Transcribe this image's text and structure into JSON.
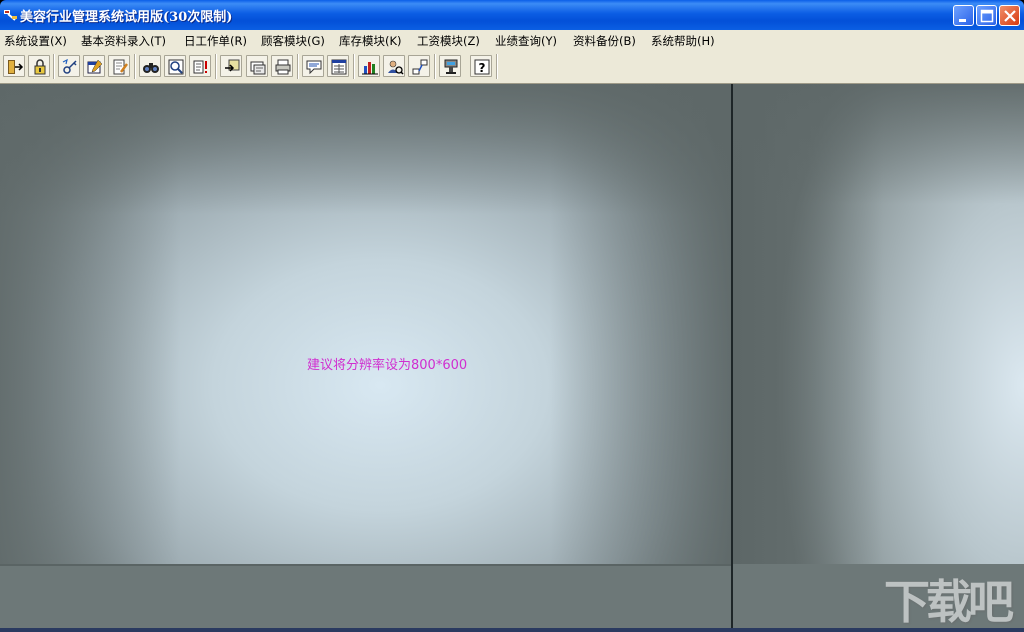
{
  "window": {
    "title": "美容行业管理系统试用版(30次限制)",
    "app_icon": "app-tools-icon",
    "controls": [
      "minimize-icon",
      "maximize-icon",
      "close-icon"
    ]
  },
  "menu": [
    {
      "label": "系统设置(X)"
    },
    {
      "label": "基本资料录入(T)"
    },
    {
      "label": "日工作单(R)"
    },
    {
      "label": "顾客模块(G)"
    },
    {
      "label": "库存模块(K)"
    },
    {
      "label": "工资模块(Z)"
    },
    {
      "label": "业绩查询(Y)"
    },
    {
      "label": "资料备份(B)"
    },
    {
      "label": "系统帮助(H)"
    }
  ],
  "toolbar": {
    "buttons": [
      "exit-icon",
      "lock-icon",
      "password-icon",
      "calendar-icon",
      "edit-icon",
      "binoculars-icon",
      "preview-icon",
      "alert-icon",
      "transfer-icon",
      "card-icon",
      "print-icon",
      "speech-icon",
      "report-icon",
      "chart-icon",
      "search-user-icon",
      "network-icon",
      "server-icon",
      "help-icon"
    ]
  },
  "main": {
    "hint": "建议将分辨率设为800*600"
  },
  "watermark": "下载吧",
  "colors": {
    "titlebar": "#0a5ee8",
    "menubar": "#ece9d8",
    "hint_text": "#d02fd0",
    "bevel_center": "#d8e8f2",
    "bevel_edge": "#6c7676"
  }
}
